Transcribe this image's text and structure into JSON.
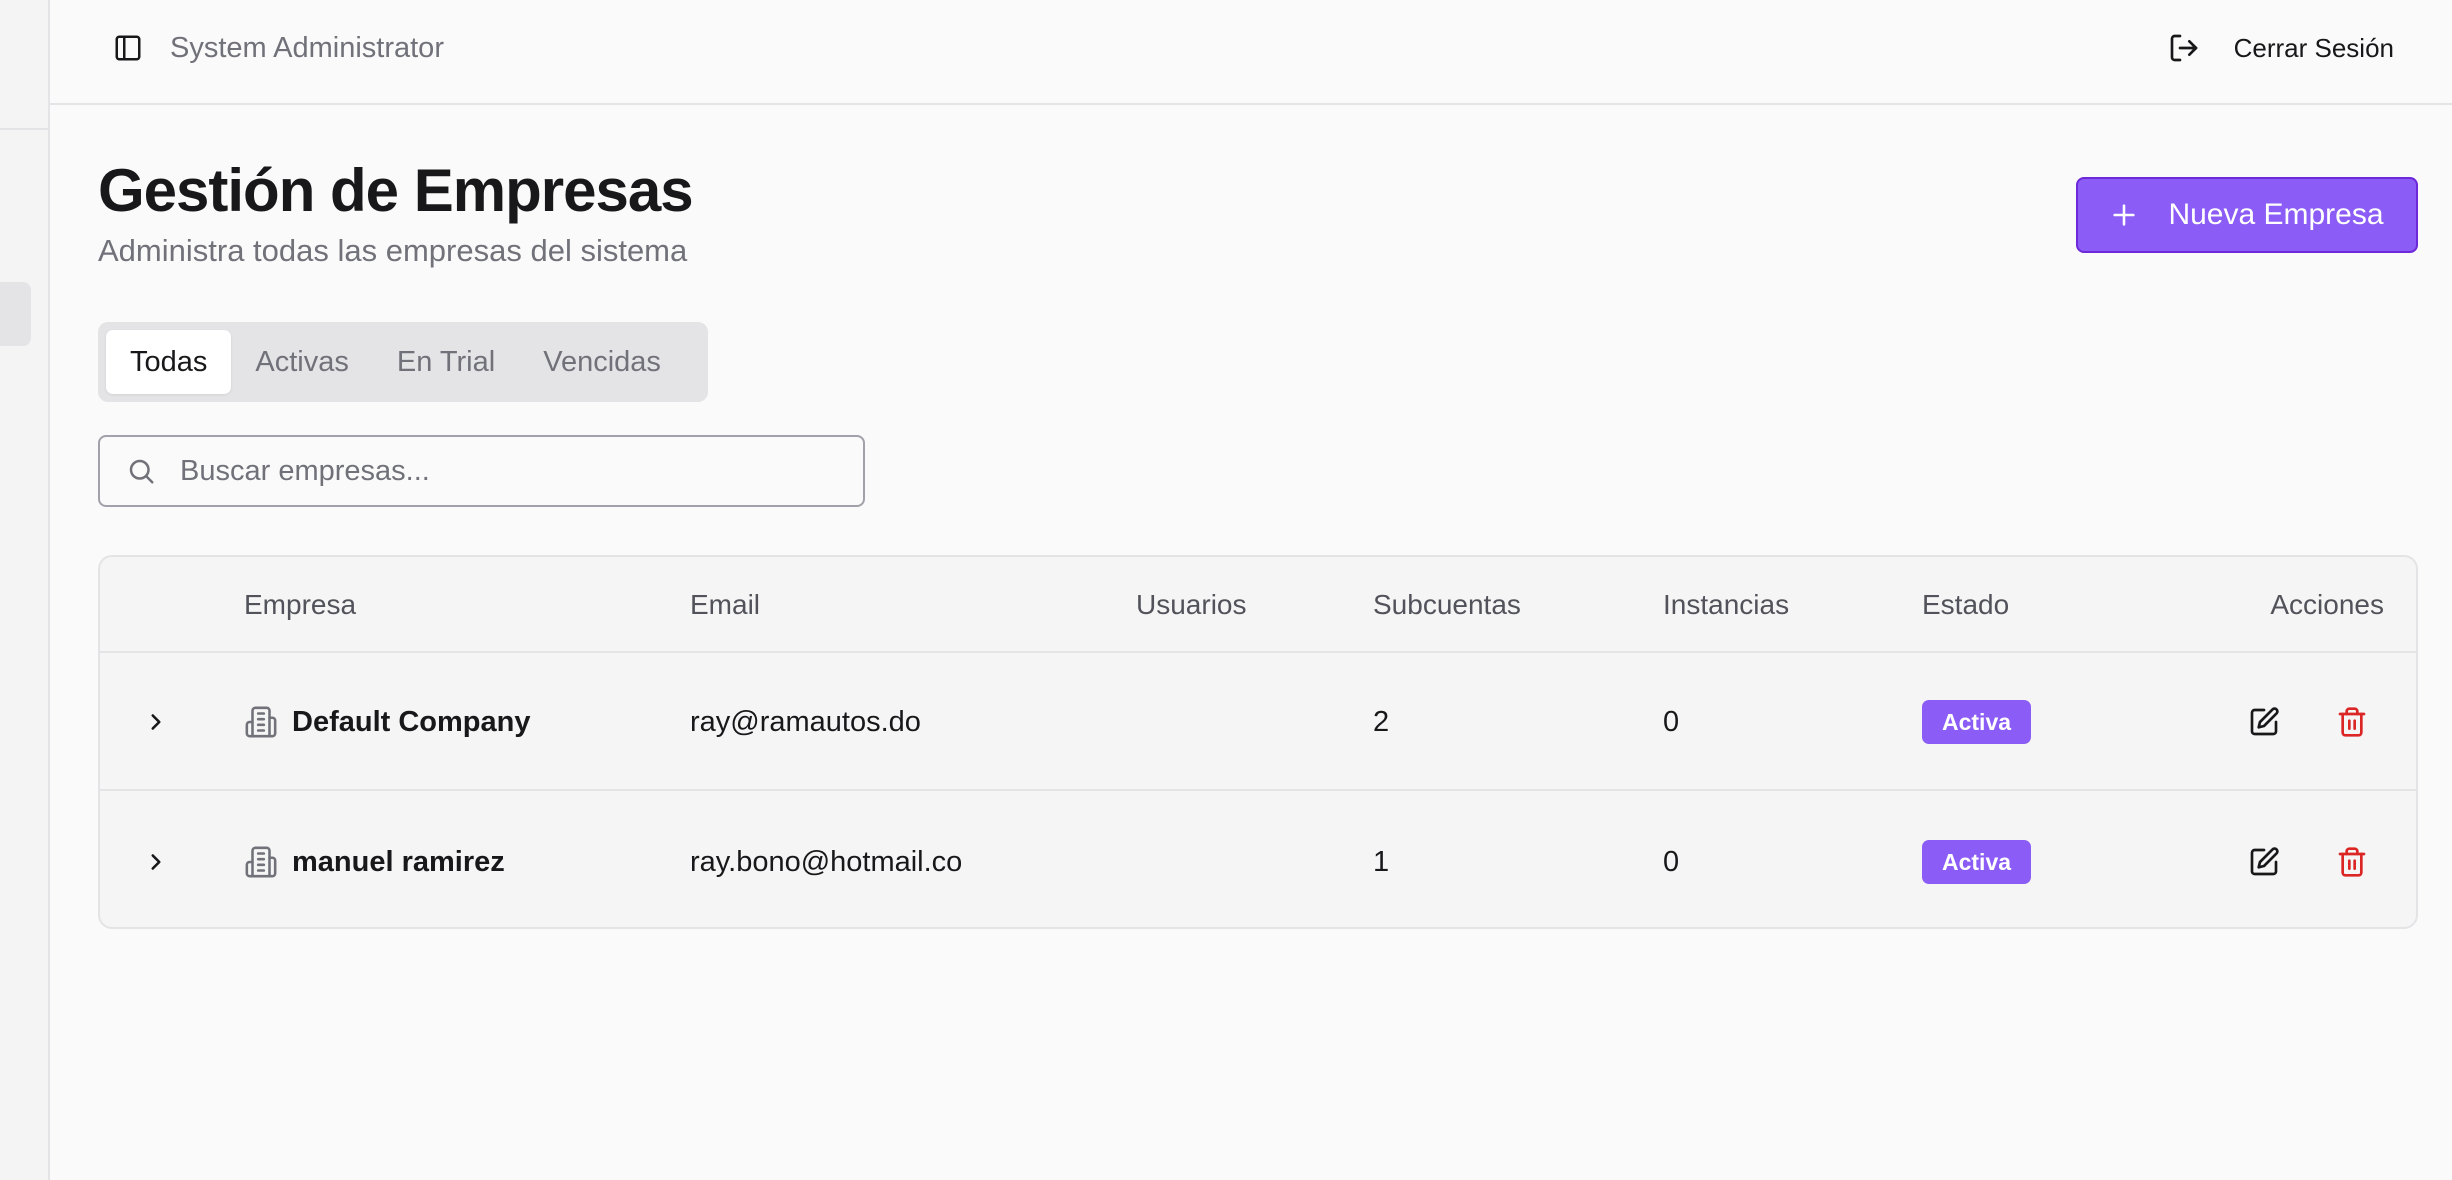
{
  "header": {
    "role": "System Administrator",
    "logout_label": "Cerrar Sesión"
  },
  "page": {
    "title": "Gestión de Empresas",
    "subtitle": "Administra todas las empresas del sistema",
    "new_button_label": "Nueva Empresa"
  },
  "tabs": [
    {
      "label": "Todas",
      "active": true
    },
    {
      "label": "Activas",
      "active": false
    },
    {
      "label": "En Trial",
      "active": false
    },
    {
      "label": "Vencidas",
      "active": false
    }
  ],
  "search": {
    "placeholder": "Buscar empresas...",
    "value": ""
  },
  "table": {
    "columns": [
      "Empresa",
      "Email",
      "Usuarios",
      "Subcuentas",
      "Instancias",
      "Estado",
      "Acciones"
    ],
    "rows": [
      {
        "empresa": "Default Company",
        "email": "ray@ramautos.do",
        "usuarios": "",
        "subcuentas": "2",
        "instancias": "0",
        "estado": "Activa"
      },
      {
        "empresa": "manuel ramirez",
        "email": "ray.bono@hotmail.co",
        "usuarios": "",
        "subcuentas": "1",
        "instancias": "0",
        "estado": "Activa"
      }
    ]
  },
  "colors": {
    "accent": "#8b5cf6",
    "danger": "#dc2626"
  },
  "icons": {
    "sidebar_toggle": "panel-left-icon",
    "logout": "log-out-icon",
    "add": "plus-icon",
    "search": "search-icon",
    "expand": "chevron-right-icon",
    "company": "building-icon",
    "edit": "edit-icon",
    "delete": "trash-icon"
  }
}
